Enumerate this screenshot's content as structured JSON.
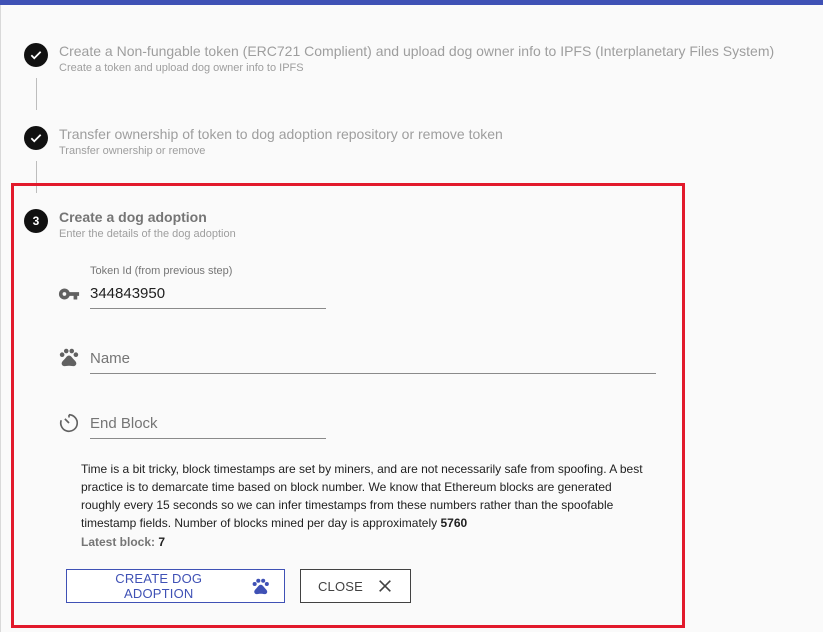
{
  "steps": [
    {
      "title": "Create a Non-fungable token (ERC721 Complient) and upload dog owner info to IPFS (Interplanetary Files System)",
      "subtitle": "Create a token and upload dog owner info to IPFS",
      "state": "done"
    },
    {
      "title": "Transfer ownership of token to dog adoption repository or remove token",
      "subtitle": "Transfer ownership or remove",
      "state": "done"
    },
    {
      "number": "3",
      "title": "Create a dog adoption",
      "subtitle": "Enter the details of the dog adoption",
      "state": "active"
    }
  ],
  "form": {
    "token": {
      "label": "Token Id (from previous step)",
      "value": "344843950"
    },
    "name": {
      "placeholder": "Name"
    },
    "end_block": {
      "placeholder": "End Block"
    }
  },
  "info": {
    "text": "Time is a bit tricky, block timestamps are set by miners, and are not necessarily safe from spoofing. A best practice is to demarcate time based on block number. We know that Ethereum blocks are generated roughly every 15 seconds so we can infer timestamps from these numbers rather than the spoofable timestamp fields. Number of blocks mined per day is approximately",
    "blocks_per_day": "5760",
    "latest_block_label": "Latest block:",
    "latest_block_value": "7"
  },
  "buttons": {
    "create_label": "CREATE DOG ADOPTION",
    "close_label": "CLOSE"
  },
  "colors": {
    "primary": "#3f51b5",
    "highlight": "#e2192b"
  }
}
